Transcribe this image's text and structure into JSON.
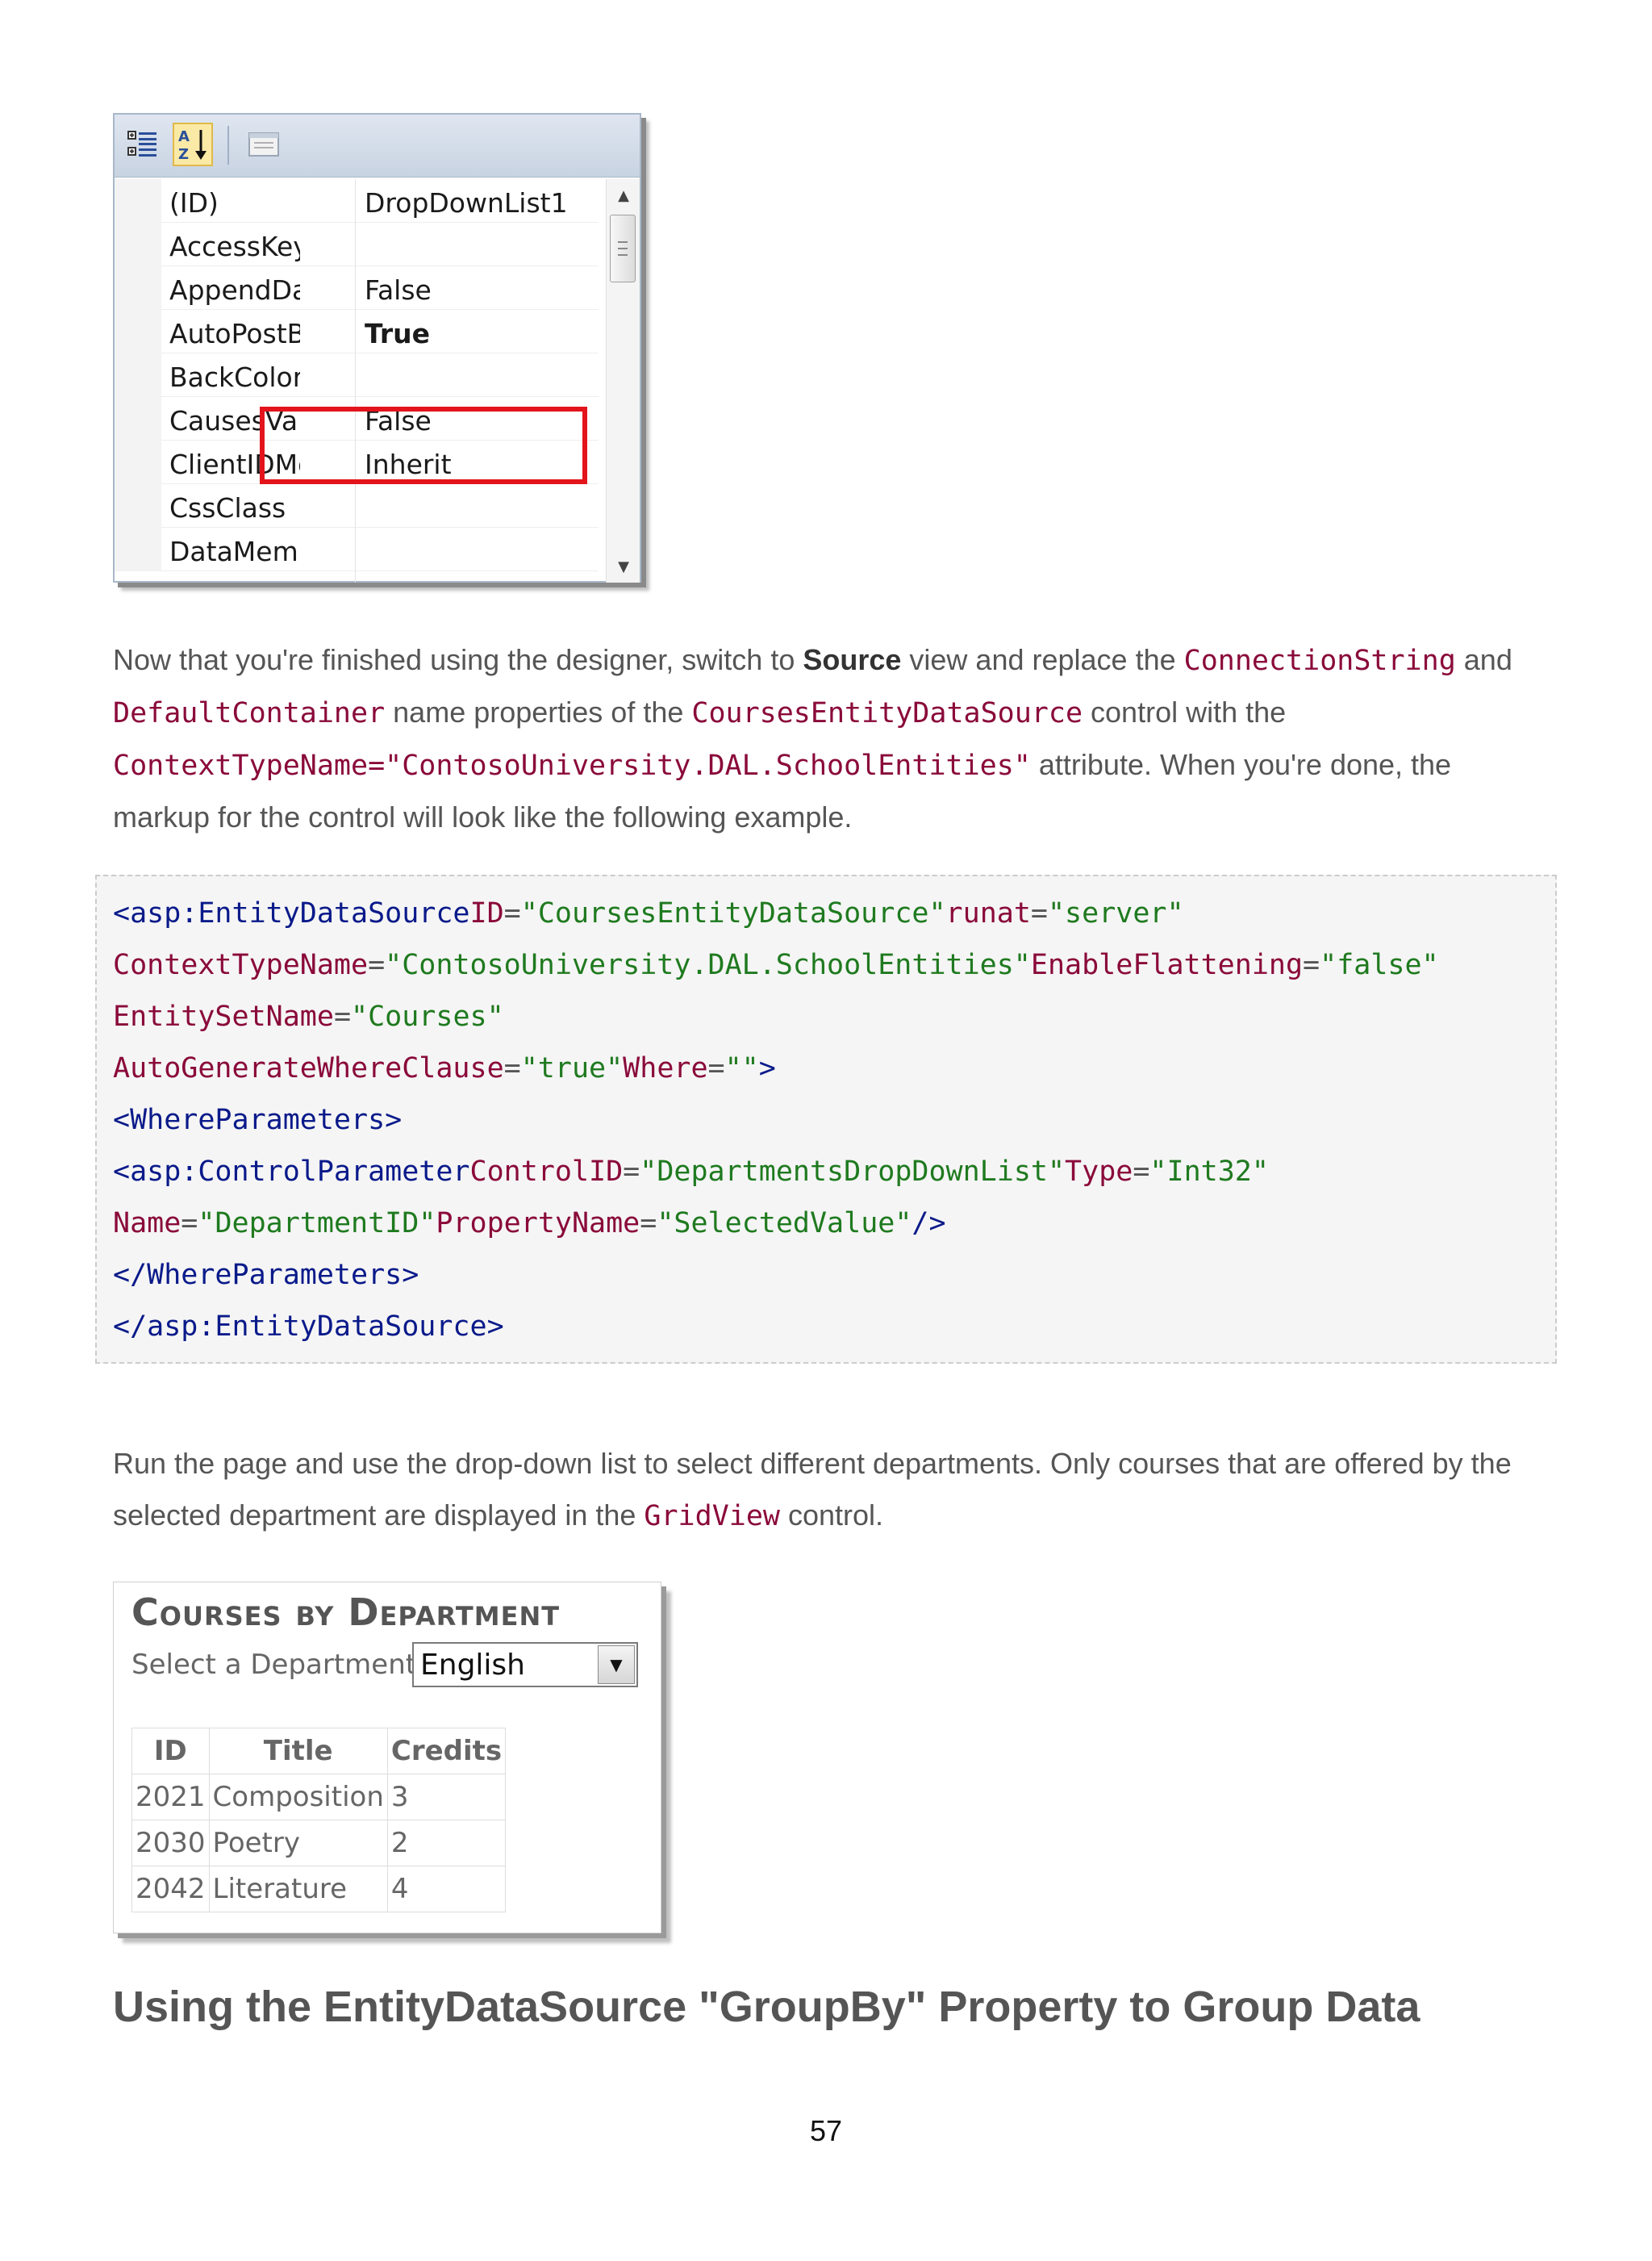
{
  "properties_window": {
    "rows": [
      {
        "name": "(ID)",
        "value": "DropDownList1",
        "bold": false
      },
      {
        "name": "AccessKey",
        "value": "",
        "bold": false
      },
      {
        "name": "AppendDataBo",
        "value": "False",
        "bold": false
      },
      {
        "name": "AutoPostBack",
        "value": "True",
        "bold": true
      },
      {
        "name": "BackColor",
        "value": "",
        "bold": false
      },
      {
        "name": "CausesValidatic",
        "value": "False",
        "bold": false
      },
      {
        "name": "ClientIDMode",
        "value": "Inherit",
        "bold": false
      },
      {
        "name": "CssClass",
        "value": "",
        "bold": false
      },
      {
        "name": "DataMember",
        "value": "",
        "bold": false
      }
    ],
    "icons": [
      "categorized-icon",
      "alphabetical-sort-icon",
      "property-pages-icon"
    ],
    "highlight_color": "#e3141b"
  },
  "para1": {
    "t1": "Now that you're finished using the designer, switch to ",
    "strong": "Source",
    "t2": " view and replace the ",
    "code1": "ConnectionString",
    "t3": " and ",
    "code2": "DefaultContainer",
    "t4": " name properties of the ",
    "code3": "CoursesEntityDataSource",
    "t5": " control with the ",
    "code4": "ContextTypeName=\"ContosoUniversity.DAL.SchoolEntities\"",
    "t6": " attribute. When you're done, the markup for the control will look like the following example."
  },
  "code_block": {
    "l1": {
      "tag": "<asp:EntityDataSource",
      "a1": "ID",
      "v1": "\"CoursesEntityDataSource\"",
      "a2": "runat",
      "v2": "\"server\""
    },
    "l2": {
      "a1": "ContextTypeName",
      "v1": "\"ContosoUniversity.DAL.SchoolEntities\"",
      "a2": "EnableFlattening",
      "v2": "\"false\""
    },
    "l3": {
      "a1": "EntitySetName",
      "v1": "\"Courses\""
    },
    "l4": {
      "a1": "AutoGenerateWhereClause",
      "v1": "\"true\"",
      "a2": "Where",
      "v2": "\"\"",
      "end": ">"
    },
    "l5": {
      "tag": "<WhereParameters>"
    },
    "l6": {
      "tag": "<asp:ControlParameter",
      "a1": "ControlID",
      "v1": "\"DepartmentsDropDownList\"",
      "a2": "Type",
      "v2": "\"Int32\""
    },
    "l7": {
      "a1": "Name",
      "v1": "\"DepartmentID\"",
      "a2": "PropertyName",
      "v2": "\"SelectedValue\"",
      "end": "/>"
    },
    "l8": {
      "tag": "</WhereParameters>"
    },
    "l9": {
      "tag": "</asp:EntityDataSource>"
    }
  },
  "para2": {
    "t1": "Run the page and use the drop-down list to select different departments. Only courses that are offered by the selected department are displayed in the ",
    "code1": "GridView",
    "t2": " control."
  },
  "courses_screen": {
    "title": "Courses by Department",
    "select_label": "Select a Department",
    "selected_department": "English",
    "columns": [
      "ID",
      "Title",
      "Credits"
    ],
    "rows": [
      [
        "2021",
        "Composition",
        "3"
      ],
      [
        "2030",
        "Poetry",
        "2"
      ],
      [
        "2042",
        "Literature",
        "4"
      ]
    ]
  },
  "heading": "Using the EntityDataSource \"GroupBy\" Property to Group Data",
  "page_number": "57",
  "colors": {
    "code_attr": "#8a0a3a",
    "code_tag": "#0a1a8a",
    "code_value": "#1f7a1f",
    "body_text": "#555555"
  }
}
